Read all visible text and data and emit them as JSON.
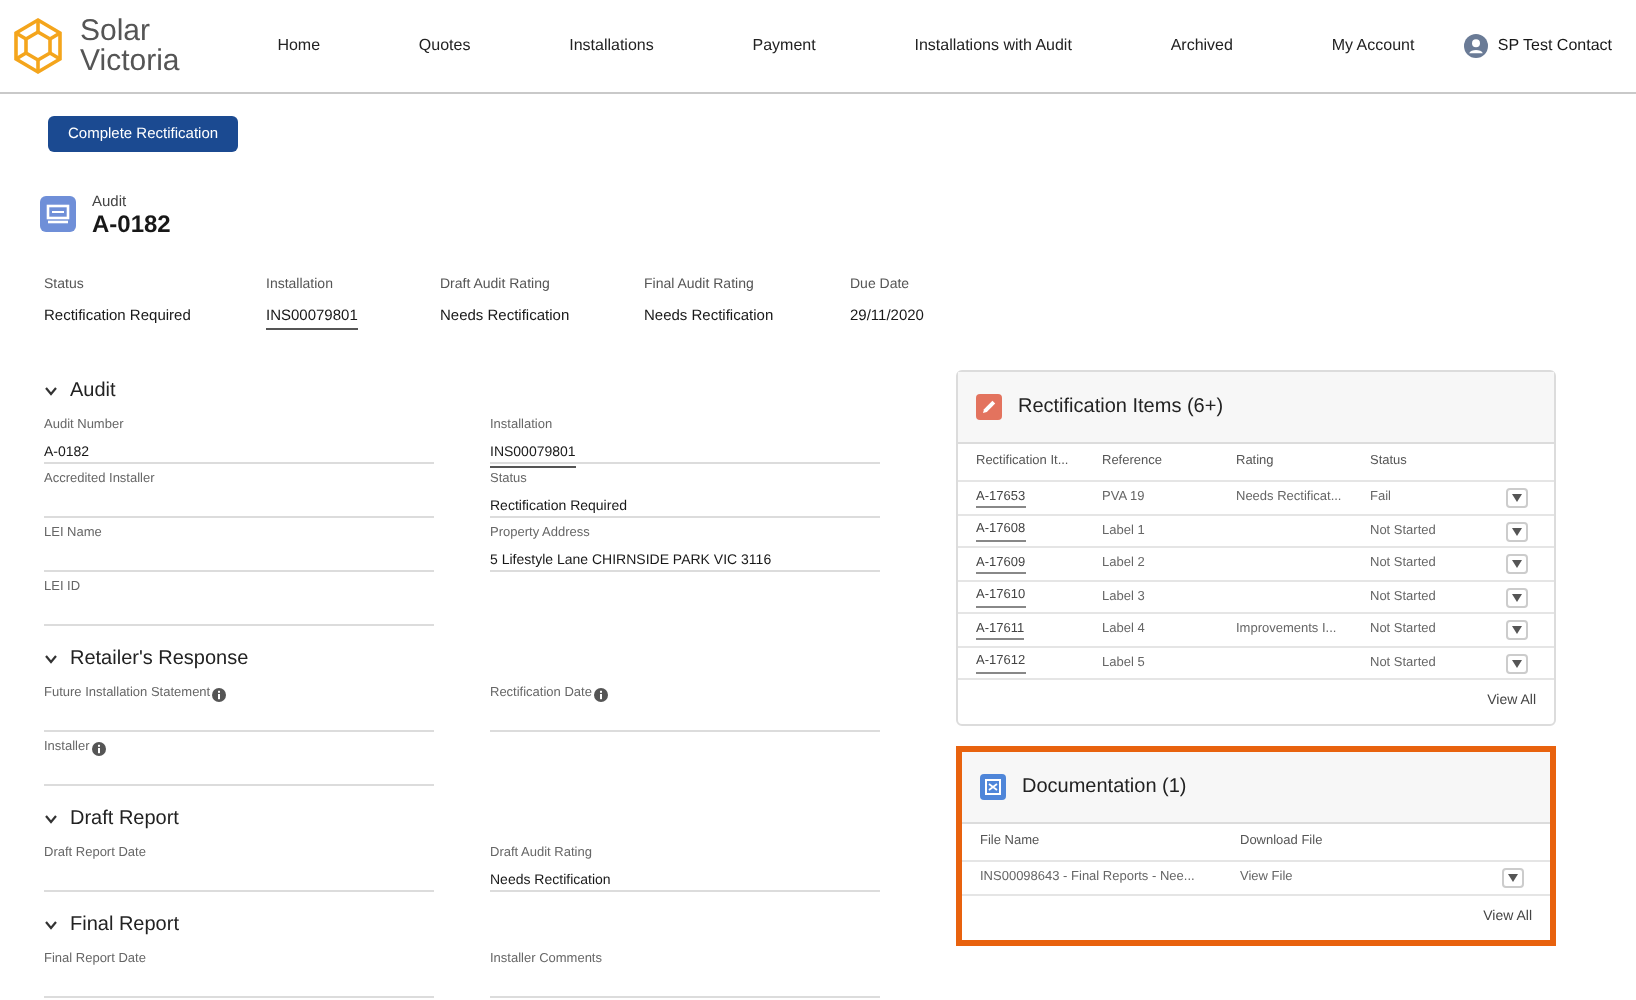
{
  "brand": {
    "line_1": "Solar",
    "line_2": "Victoria"
  },
  "nav": [
    {
      "label": "Home"
    },
    {
      "label": "Quotes"
    },
    {
      "label": "Installations"
    },
    {
      "label": "Payment"
    },
    {
      "label": "Installations with Audit"
    },
    {
      "label": "Archived"
    },
    {
      "label": "My Account"
    }
  ],
  "user": {
    "name": "SP Test Contact"
  },
  "action_button": "Complete Rectification",
  "record": {
    "type": "Audit",
    "name": "A-0182"
  },
  "highlights": [
    {
      "label": "Status",
      "value": "Rectification Required",
      "link": false
    },
    {
      "label": "Installation",
      "value": "INS00079801",
      "link": true
    },
    {
      "label": "Draft Audit Rating",
      "value": "Needs Rectification",
      "link": false
    },
    {
      "label": "Final Audit Rating",
      "value": "Needs Rectification",
      "link": false
    },
    {
      "label": "Due Date",
      "value": "29/11/2020",
      "link": false
    }
  ],
  "sections": [
    {
      "title": "Audit",
      "expanded": true,
      "rows": [
        [
          {
            "label": "Audit Number",
            "value": "A-0182",
            "link": false,
            "info": false
          },
          {
            "label": "Installation",
            "value": "INS00079801",
            "link": true,
            "info": false
          }
        ],
        [
          {
            "label": "Accredited Installer",
            "info": false
          },
          {
            "label": "Status",
            "value": "Rectification Required",
            "link": false,
            "info": false
          }
        ],
        [
          {
            "label": "LEI Name",
            "info": false
          },
          {
            "label": "Property Address",
            "value": "5 Lifestyle Lane CHIRNSIDE PARK VIC 3116",
            "link": false,
            "info": false
          }
        ],
        [
          {
            "label": "LEI ID",
            "info": false
          },
          null
        ]
      ]
    },
    {
      "title": "Retailer's Response",
      "expanded": true,
      "rows": [
        [
          {
            "label": "Future Installation Statement",
            "info": true
          },
          {
            "label": "Rectification Date",
            "info": true
          }
        ],
        [
          {
            "label": "Installer",
            "info": true
          },
          null
        ]
      ]
    },
    {
      "title": "Draft Report",
      "expanded": true,
      "rows": [
        [
          {
            "label": "Draft Report Date",
            "info": false
          },
          {
            "label": "Draft Audit Rating",
            "value": "Needs Rectification",
            "link": false,
            "info": false
          }
        ]
      ]
    },
    {
      "title": "Final Report",
      "expanded": true,
      "rows": [
        [
          {
            "label": "Final Report Date",
            "info": false
          },
          {
            "label": "Installer Comments",
            "info": false
          }
        ]
      ]
    }
  ],
  "rectification_items": {
    "title": "Rectification Items (6+)",
    "columns": [
      "Rectification It...",
      "Reference",
      "Rating",
      "Status"
    ],
    "rows": [
      {
        "item": "A-17653",
        "reference": "PVA 19",
        "rating": "Needs Rectificat...",
        "status": "Fail"
      },
      {
        "item": "A-17608",
        "reference": "Label 1",
        "status": "Not Started"
      },
      {
        "item": "A-17609",
        "reference": "Label 2",
        "status": "Not Started"
      },
      {
        "item": "A-17610",
        "reference": "Label 3",
        "status": "Not Started"
      },
      {
        "item": "A-17611",
        "reference": "Label 4",
        "rating": "Improvements I...",
        "status": "Not Started"
      },
      {
        "item": "A-17612",
        "reference": "Label 5",
        "status": "Not Started"
      }
    ],
    "footer_link": "View All"
  },
  "documentation": {
    "title": "Documentation (1)",
    "highlighted": true,
    "columns": [
      "File Name",
      "Download File"
    ],
    "rows": [
      {
        "file_name": "INS00098643 - Final Reports - Nee...",
        "download": "View File"
      }
    ],
    "footer_link": "View All"
  }
}
